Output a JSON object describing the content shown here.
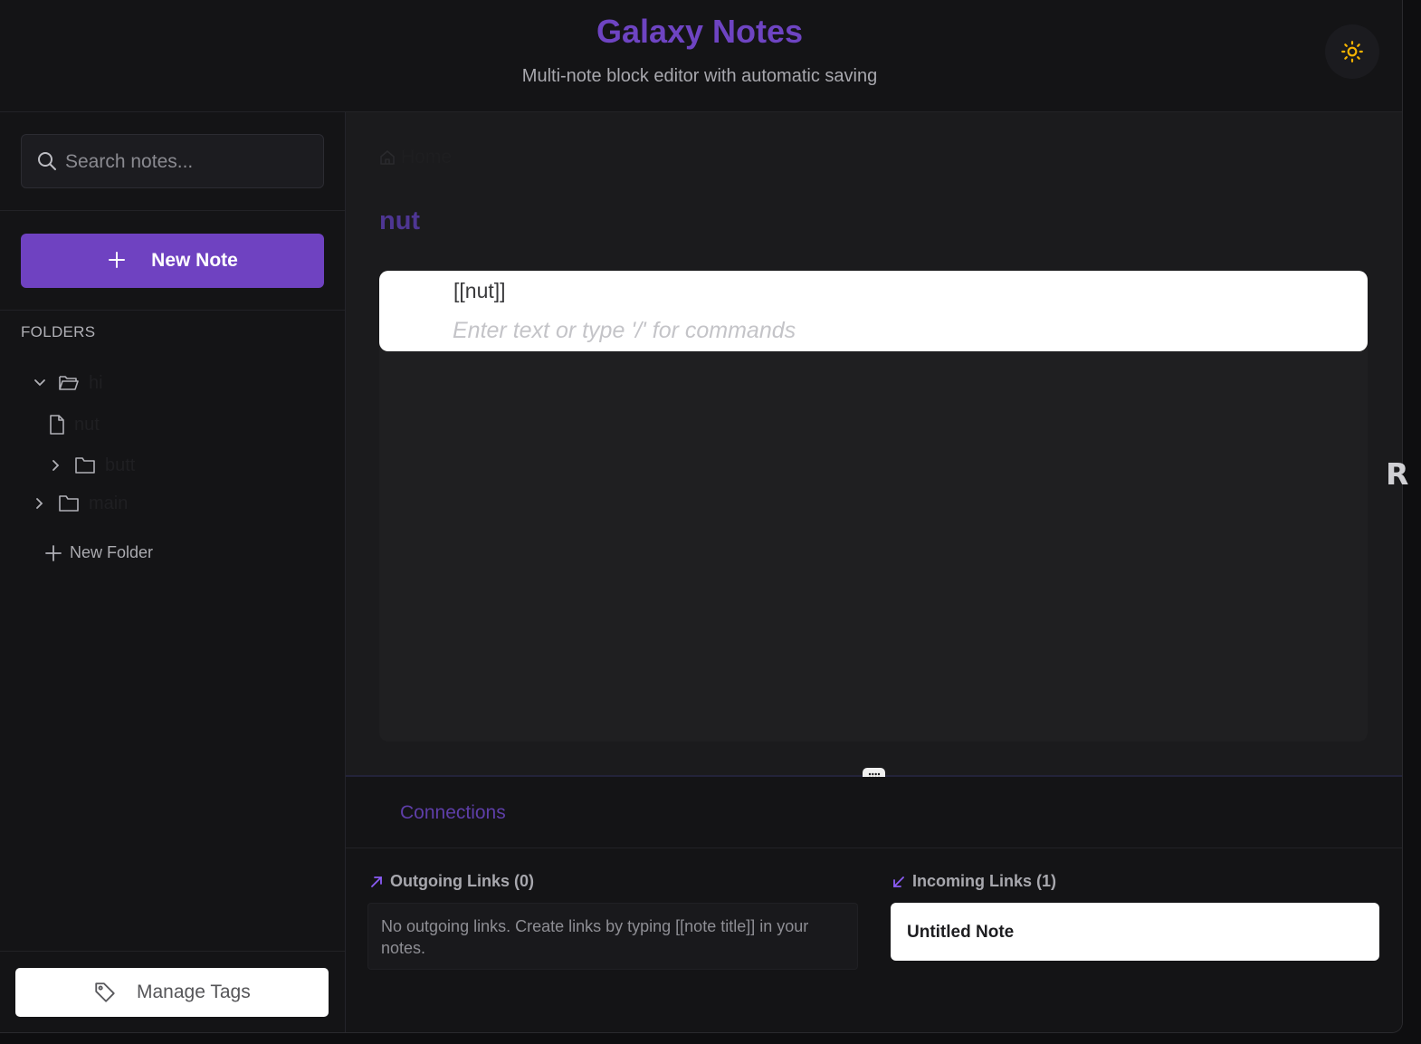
{
  "header": {
    "title": "Galaxy Notes",
    "subtitle": "Multi-note block editor with automatic saving",
    "theme_toggle_icon": "sun-icon"
  },
  "sidebar": {
    "search": {
      "placeholder": "Search notes...",
      "value": ""
    },
    "new_note_label": "New Note",
    "folders_heading": "FOLDERS",
    "tree": [
      {
        "type": "folder",
        "name": "hi",
        "expanded": true,
        "icon": "folder-open-icon"
      },
      {
        "type": "note",
        "name": "nut",
        "icon": "file-icon"
      },
      {
        "type": "folder",
        "name": "butt",
        "expanded": false,
        "icon": "folder-icon"
      },
      {
        "type": "folder",
        "name": "main",
        "expanded": false,
        "icon": "folder-icon"
      }
    ],
    "new_folder_label": "New Folder",
    "manage_tags_label": "Manage Tags"
  },
  "main": {
    "breadcrumb": {
      "home_label": "Home"
    },
    "note_title": "nut",
    "editor": {
      "blocks": [
        {
          "content": "[[nut]]"
        }
      ],
      "placeholder": "Enter text or type '/' for commands"
    }
  },
  "connections": {
    "tab_label": "Connections",
    "outgoing": {
      "heading": "Outgoing Links (0)",
      "empty_text": "No outgoing links. Create links by typing [[note title]] in your notes."
    },
    "incoming": {
      "heading": "Incoming Links (1)",
      "items": [
        {
          "title": "Untitled Note"
        }
      ]
    }
  },
  "overlay": {
    "side_letter": "R"
  },
  "colors": {
    "accent": "#6f42c1",
    "title": "#6e44c2",
    "background": "#141416",
    "sun": "#f5b301"
  }
}
